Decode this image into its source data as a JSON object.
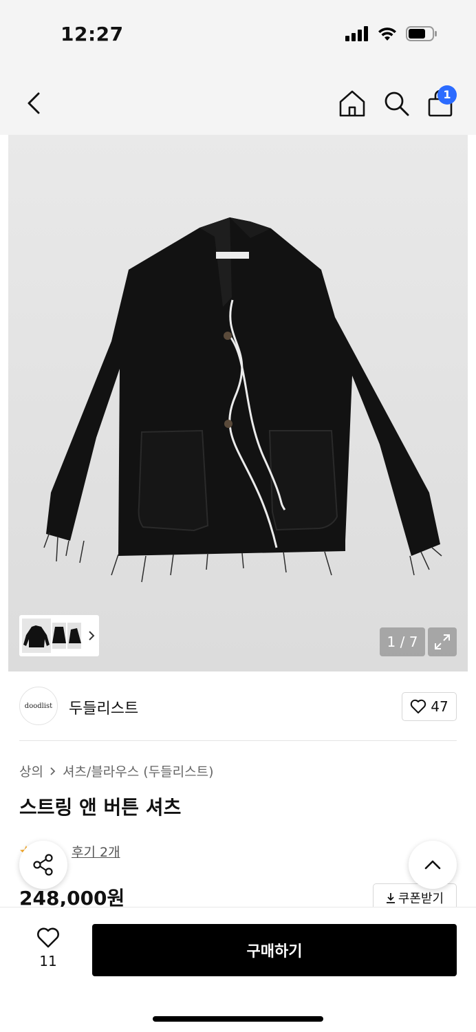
{
  "status_bar": {
    "time": "12:27"
  },
  "nav": {
    "cart_badge": "1"
  },
  "gallery": {
    "counter": "1 / 7"
  },
  "brand": {
    "logo_text": "doodlist",
    "name": "두들리스트",
    "like_count": "47"
  },
  "breadcrumb": {
    "category": "상의",
    "subcategory": "셔츠/블라우스 (두들리스트)"
  },
  "product": {
    "title": "스트링 앤 버튼 셔츠",
    "review_link": "후기 2개",
    "price": "248,000원"
  },
  "coupon": {
    "label": "쿠폰받기"
  },
  "bottom": {
    "wish_count": "11",
    "buy_label": "구매하기"
  },
  "colors": {
    "badge": "#2b6bff",
    "buy_button": "#000000",
    "star": "#f5a623"
  },
  "icons": [
    "back-icon",
    "home-icon",
    "search-icon",
    "shopping-bag-icon",
    "expand-icon",
    "heart-icon",
    "share-icon",
    "chevron-up-icon",
    "download-icon",
    "star-icon",
    "chevron-right-icon"
  ]
}
